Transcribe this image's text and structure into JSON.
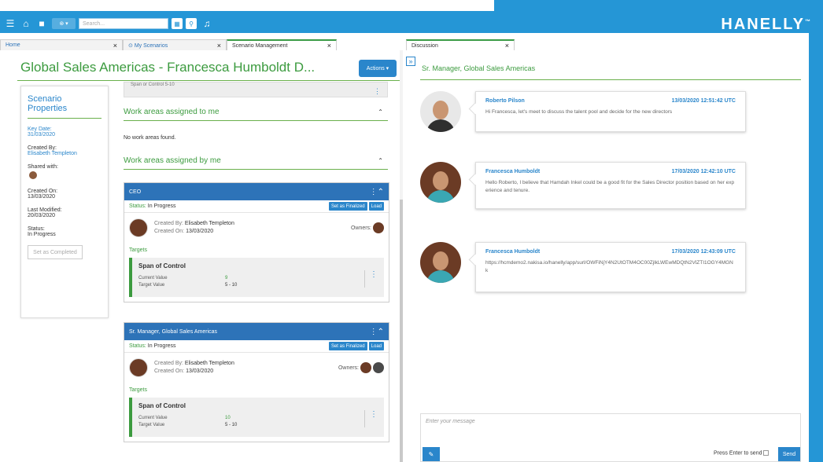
{
  "topbar": {
    "search_placeholder": "Search...",
    "brand": "HANELLY",
    "brand_mark": "™"
  },
  "tabs": {
    "left": [
      {
        "label": "Home"
      },
      {
        "label": "My Scenarios"
      },
      {
        "label": "Scenario Management"
      }
    ],
    "right": [
      {
        "label": "Discussion"
      }
    ]
  },
  "left": {
    "title": "Global Sales Americas - Francesca Humboldt D...",
    "actions_label": "Actions ▾",
    "props": {
      "title": "Scenario Properties",
      "key_date_label": "Key Date:",
      "key_date": "31/03/2020",
      "created_by_label": "Created By:",
      "created_by": "Elisabeth Templeton",
      "shared_label": "Shared with:",
      "created_on_label": "Created On:",
      "created_on": "13/03/2020",
      "modified_label": "Last Modified:",
      "modified": "20/03/2020",
      "status_label": "Status:",
      "status": "In Progress",
      "complete_btn": "Set as Completed"
    },
    "collapsed_card_text": "Span or Control 5-10",
    "section1": {
      "title": "Work areas assigned to me",
      "empty": "No work areas found."
    },
    "section2": {
      "title": "Work areas assigned by me"
    },
    "cards": [
      {
        "title": "CEO",
        "status_label": "Status:",
        "status": "In Progress",
        "btn_finalize": "Set as Finalized",
        "btn_load": "Load",
        "created_by_label": "Created By:",
        "created_by": "Elisabeth Templeton",
        "created_on_label": "Created On:",
        "created_on": "13/03/2020",
        "owners_label": "Owners:",
        "targets_label": "Targets",
        "kpi_title": "Span of Control",
        "current_label": "Current Value",
        "current": "9",
        "target_label": "Target Value",
        "target": "5 - 10"
      },
      {
        "title": "Sr. Manager, Global Sales Americas",
        "status_label": "Status:",
        "status": "In Progress",
        "btn_finalize": "Set as Finalized",
        "btn_load": "Load",
        "created_by_label": "Created By:",
        "created_by": "Elisabeth Templeton",
        "created_on_label": "Created On:",
        "created_on": "13/03/2020",
        "owners_label": "Owners:",
        "targets_label": "Targets",
        "kpi_title": "Span of Control",
        "current_label": "Current Value",
        "current": "10",
        "target_label": "Target Value",
        "target": "5 - 10"
      }
    ]
  },
  "discussion": {
    "title": "Sr. Manager, Global Sales Americas",
    "messages": [
      {
        "author": "Roberto Pilson",
        "time": "13/03/2020 12:51:42 UTC",
        "text": "Hi Francesca, let's meet to discuss the talent pool and decide for the new directors"
      },
      {
        "author": "Francesca Humboldt",
        "time": "17/03/2020 12:42:10 UTC",
        "text": "Hello Roberto, I believe that Hamdah Inkel could be a good fit for the Sales Director position based on her experience and tenure."
      },
      {
        "author": "Francesca Humboldt",
        "time": "17/03/2020 12:43:09 UTC",
        "text": "https://hcmdemo2.nakisa.io/hanelly/app/surl/OWFiNjY4N2UtOTM4OC00ZjlkLWEwMDQtN2VlZTI1OGY4MGNk"
      }
    ],
    "compose_placeholder": "Enter your message",
    "enter_label": "Press Enter to send",
    "send_label": "Send"
  }
}
